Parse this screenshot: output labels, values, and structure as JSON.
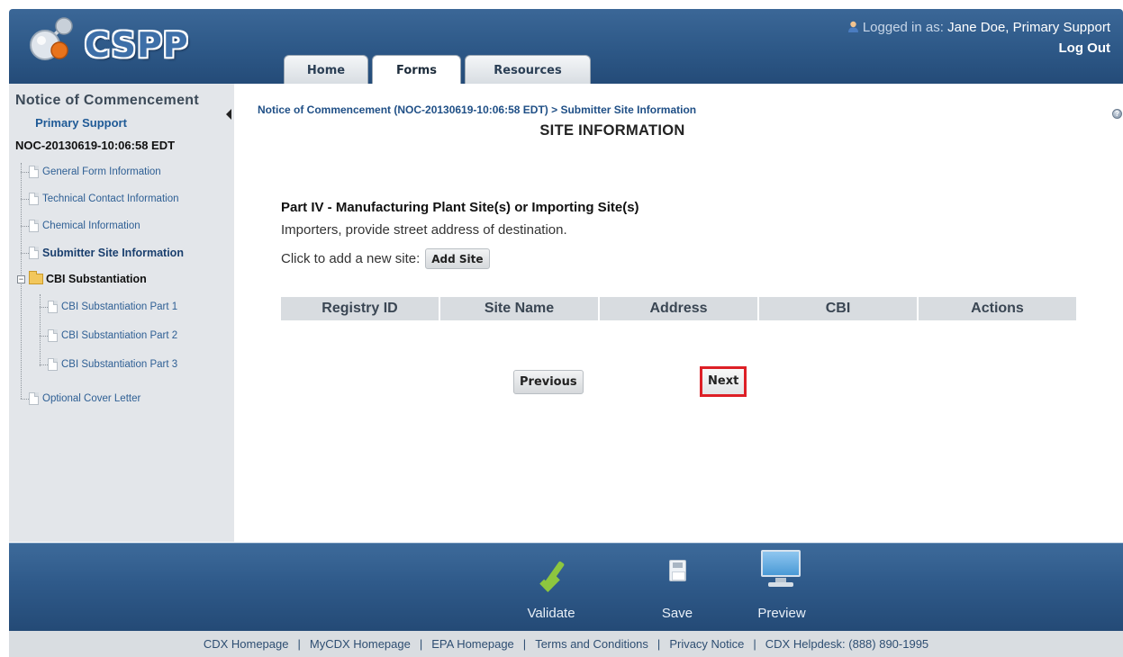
{
  "app": {
    "logo_text": "CSPP",
    "tabs": [
      "Home",
      "Forms",
      "Resources"
    ],
    "active_tab": "Forms",
    "user_prefix": "Logged in as:",
    "user_name": "Jane Doe, Primary Support",
    "logout_label": "Log Out"
  },
  "sidebar": {
    "title": "Notice of Commencement",
    "subtitle": "Primary Support",
    "record_id": "NOC-20130619-10:06:58 EDT",
    "items": [
      {
        "label": "General Form Information"
      },
      {
        "label": "Technical Contact Information"
      },
      {
        "label": "Chemical Information"
      },
      {
        "label": "Submitter Site Information",
        "current": true
      },
      {
        "label": "CBI Substantiation",
        "group": true
      },
      {
        "label": "CBI Substantiation Part 1"
      },
      {
        "label": "CBI Substantiation Part 2"
      },
      {
        "label": "CBI Substantiation Part 3"
      },
      {
        "label": "Optional Cover Letter"
      }
    ]
  },
  "main": {
    "breadcrumb": "Notice of Commencement (NOC-20130619-10:06:58 EDT) > Submitter Site Information",
    "page_title": "SITE INFORMATION",
    "part_title": "Part IV - Manufacturing Plant Site(s) or Importing Site(s)",
    "instruction": "Importers, provide street address of destination.",
    "add_prompt": "Click to add a new site:",
    "add_button": "Add Site",
    "columns": [
      "Registry ID",
      "Site Name",
      "Address",
      "CBI",
      "Actions"
    ],
    "previous_button": "Previous",
    "next_button": "Next"
  },
  "toolbar": {
    "validate_label": "Validate",
    "save_label": "Save",
    "preview_label": "Preview"
  },
  "footer": {
    "links": [
      "CDX Homepage",
      "MyCDX Homepage",
      "EPA Homepage",
      "Terms and Conditions",
      "Privacy Notice",
      "CDX Helpdesk: (888) 890-1995"
    ]
  },
  "colors": {
    "header_blue": "#2d5887",
    "sidebar_gray": "#e3e6ea",
    "highlight_red": "#dd1f26",
    "check_green": "#8dc63f"
  }
}
